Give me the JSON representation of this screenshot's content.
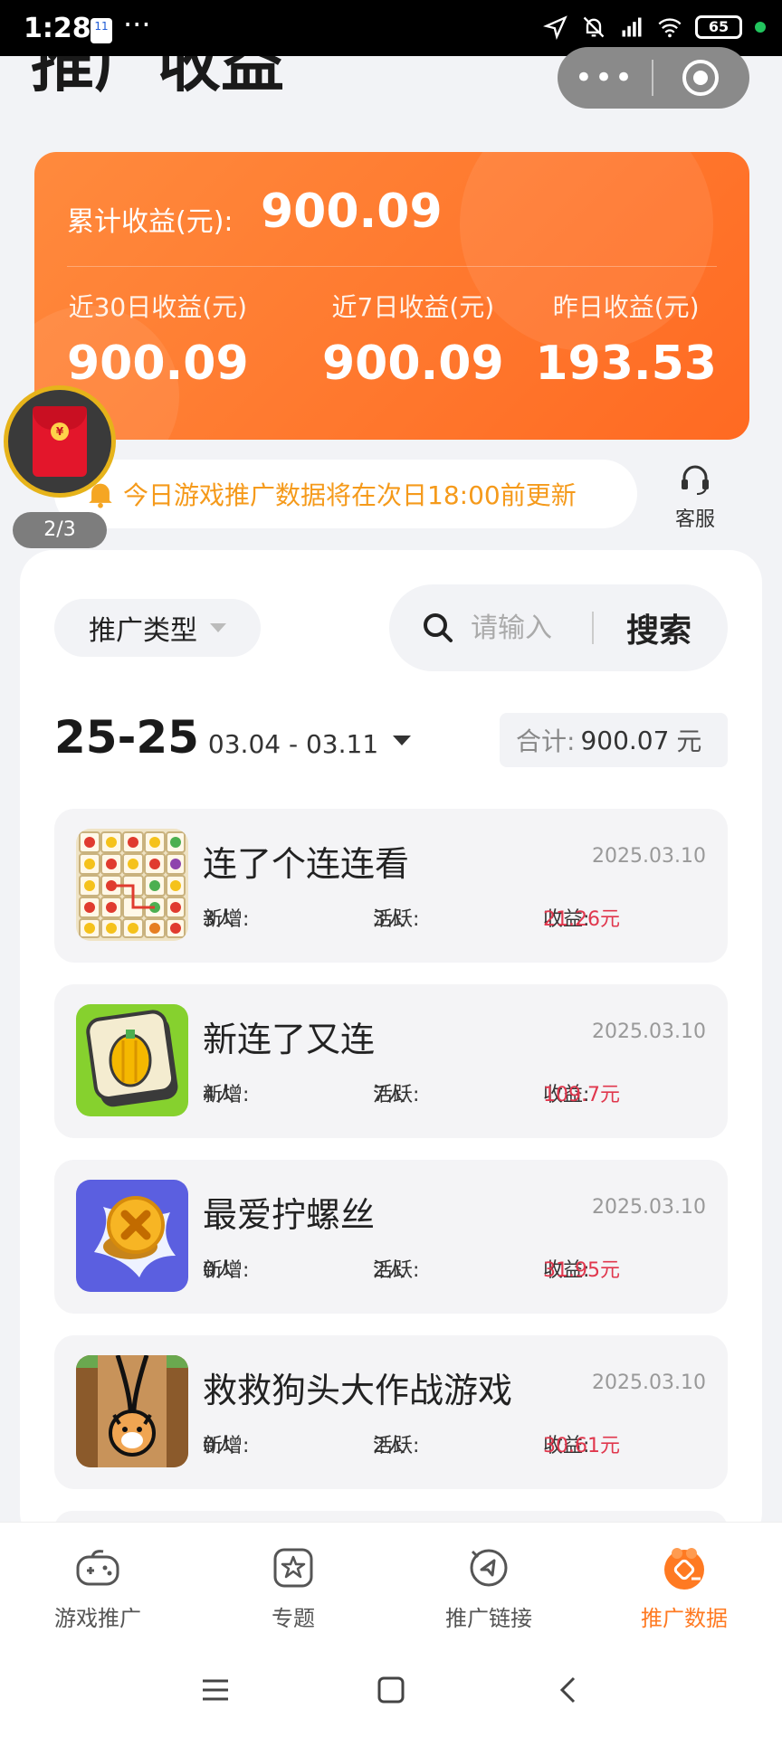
{
  "status_bar": {
    "time": "1:28",
    "calendar_day": "11",
    "more": "···",
    "battery": "65"
  },
  "header": {
    "title": "推广收益",
    "capsule_more": "•••"
  },
  "earnings": {
    "total_label": "累计收益(元):",
    "total_value": "900.09",
    "stats": [
      {
        "label": "近30日收益(元)",
        "value": "900.09"
      },
      {
        "label": "近7日收益(元)",
        "value": "900.09"
      },
      {
        "label": "昨日收益(元)",
        "value": "193.53"
      }
    ]
  },
  "envelope": {
    "coin": "¥",
    "count": "2/3"
  },
  "notice": {
    "text": "今日游戏推广数据将在次日18:00前更新"
  },
  "service": {
    "label": "客服"
  },
  "filters": {
    "type_label": "推广类型",
    "search_placeholder": "请输入",
    "search_button": "搜索"
  },
  "date_range": {
    "year": "25-25",
    "range": "03.04 - 03.11"
  },
  "total": {
    "label": "合计:",
    "value": "900.07",
    "unit": "元"
  },
  "games": [
    {
      "name": "连了个连连看",
      "date": "2025.03.10",
      "new_label": "新增:",
      "new_value": "3人",
      "active_label": "活跃:",
      "active_value": "3人",
      "revenue_label": "收益:",
      "revenue_value": "21.26元"
    },
    {
      "name": "新连了又连",
      "date": "2025.03.10",
      "new_label": "新增:",
      "new_value": "4人",
      "active_label": "活跃:",
      "active_value": "7人",
      "revenue_label": "收益:",
      "revenue_value": "109.7元"
    },
    {
      "name": "最爱拧螺丝",
      "date": "2025.03.10",
      "new_label": "新增:",
      "new_value": "0人",
      "active_label": "活跃:",
      "active_value": "2人",
      "revenue_label": "收益:",
      "revenue_value": "31.95元"
    },
    {
      "name": "救救狗头大作战游戏",
      "date": "2025.03.10",
      "new_label": "新增:",
      "new_value": "0人",
      "active_label": "活跃:",
      "active_value": "2人",
      "revenue_label": "收益:",
      "revenue_value": "30.61元"
    }
  ],
  "bottom_nav": [
    {
      "label": "游戏推广",
      "icon": "gamepad-icon"
    },
    {
      "label": "专题",
      "icon": "star-box-icon"
    },
    {
      "label": "推广链接",
      "icon": "link-icon"
    },
    {
      "label": "推广数据",
      "icon": "data-icon",
      "active": true
    }
  ],
  "colors": {
    "accent": "#ff7a22",
    "card_gradient_start": "#ff8a3d",
    "card_gradient_end": "#ff6a22",
    "notice_text": "#f59a1b",
    "revenue": "#e0374d"
  }
}
